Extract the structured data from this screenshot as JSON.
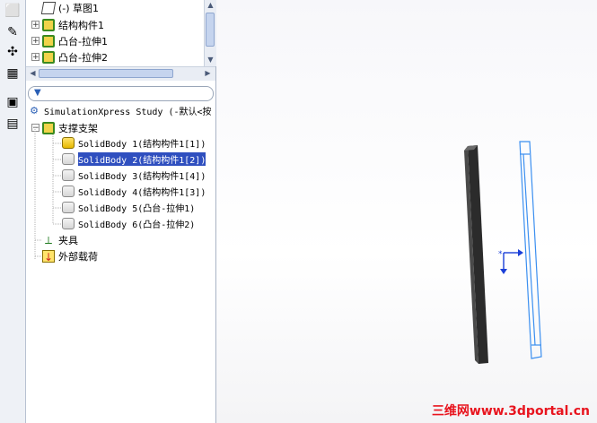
{
  "tree_top": {
    "items": [
      {
        "label": "(-) 草图1"
      },
      {
        "label": "结构构件1"
      },
      {
        "label": "凸台-拉伸1"
      },
      {
        "label": "凸台-拉伸2"
      }
    ]
  },
  "study": {
    "title": "SimulationXpress Study (-默认<按",
    "group_label": "支撑支架",
    "bodies": [
      {
        "label": "SolidBody 1(结构构件1[1])"
      },
      {
        "label": "SolidBody 2(结构构件1[2])"
      },
      {
        "label": "SolidBody 3(结构构件1[4])"
      },
      {
        "label": "SolidBody 4(结构构件1[3])"
      },
      {
        "label": "SolidBody 5(凸台-拉伸1)"
      },
      {
        "label": "SolidBody 6(凸台-拉伸2)"
      }
    ],
    "fixtures_label": "夹具",
    "loads_label": "外部载荷"
  },
  "watermark": "三维网www.3dportal.cn",
  "colors": {
    "selection": "#2f4fbf",
    "model_solid": "#2b2b2b",
    "model_selected": "#3b8ff0",
    "watermark": "#e8141e"
  }
}
